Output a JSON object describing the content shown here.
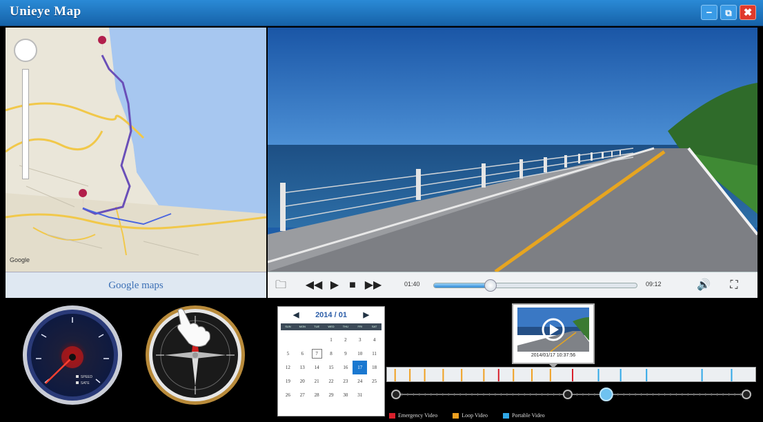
{
  "window": {
    "title": "Unieye Map",
    "buttons": {
      "minimize": "−",
      "maximize": "⧉",
      "close": "✖"
    }
  },
  "map": {
    "footer_label": "Google maps",
    "logo_text": "Google"
  },
  "player": {
    "current_time": "01:40",
    "total_time": "09:12",
    "progress_fraction": 0.28,
    "controls": {
      "folder": "🗀",
      "rewind": "◀◀",
      "play": "▶",
      "stop": "■",
      "forward": "▶▶",
      "volume": "🔊",
      "fullscreen": "⛶"
    }
  },
  "calendar": {
    "month_label": "2014 / 01",
    "prev": "◀",
    "next": "▶",
    "weekdays": [
      "SUN",
      "MON",
      "TUE",
      "WED",
      "THU",
      "FRI",
      "SAT"
    ],
    "days": [
      "",
      "",
      "",
      "1",
      "2",
      "3",
      "4",
      "5",
      "6",
      "7",
      "8",
      "9",
      "10",
      "11",
      "12",
      "13",
      "14",
      "15",
      "16",
      "17",
      "18",
      "19",
      "20",
      "21",
      "22",
      "23",
      "24",
      "25",
      "26",
      "27",
      "28",
      "29",
      "30",
      "31",
      ""
    ],
    "selected_day": "17",
    "today_day": "7"
  },
  "thumbnail": {
    "caption": "2014/01/17 10:37:56"
  },
  "legend": [
    {
      "label": "Emergency Video",
      "color": "#d8202c"
    },
    {
      "label": "Loop Video",
      "color": "#f0a020"
    },
    {
      "label": "Portable Video",
      "color": "#30a8e8"
    }
  ],
  "timeline": {
    "events": [
      {
        "pos": 0.02,
        "type": "loop"
      },
      {
        "pos": 0.06,
        "type": "loop"
      },
      {
        "pos": 0.1,
        "type": "loop"
      },
      {
        "pos": 0.15,
        "type": "loop"
      },
      {
        "pos": 0.2,
        "type": "loop"
      },
      {
        "pos": 0.26,
        "type": "loop"
      },
      {
        "pos": 0.3,
        "type": "emergency"
      },
      {
        "pos": 0.34,
        "type": "loop"
      },
      {
        "pos": 0.39,
        "type": "loop"
      },
      {
        "pos": 0.44,
        "type": "loop"
      },
      {
        "pos": 0.5,
        "type": "emergency"
      },
      {
        "pos": 0.57,
        "type": "portable"
      },
      {
        "pos": 0.63,
        "type": "portable"
      },
      {
        "pos": 0.7,
        "type": "portable"
      },
      {
        "pos": 0.85,
        "type": "portable"
      },
      {
        "pos": 0.93,
        "type": "portable"
      }
    ],
    "markers": [
      0.0,
      0.49,
      1.0
    ],
    "position_fraction": 0.6
  },
  "gauges": {
    "speedometer_labels": [
      "SPEED",
      "SATE"
    ]
  },
  "colors": {
    "titlebar": "#1a6fb8",
    "accent": "#2f8ad8",
    "emergency": "#d8202c",
    "loop": "#f0a020",
    "portable": "#30a8e8"
  }
}
